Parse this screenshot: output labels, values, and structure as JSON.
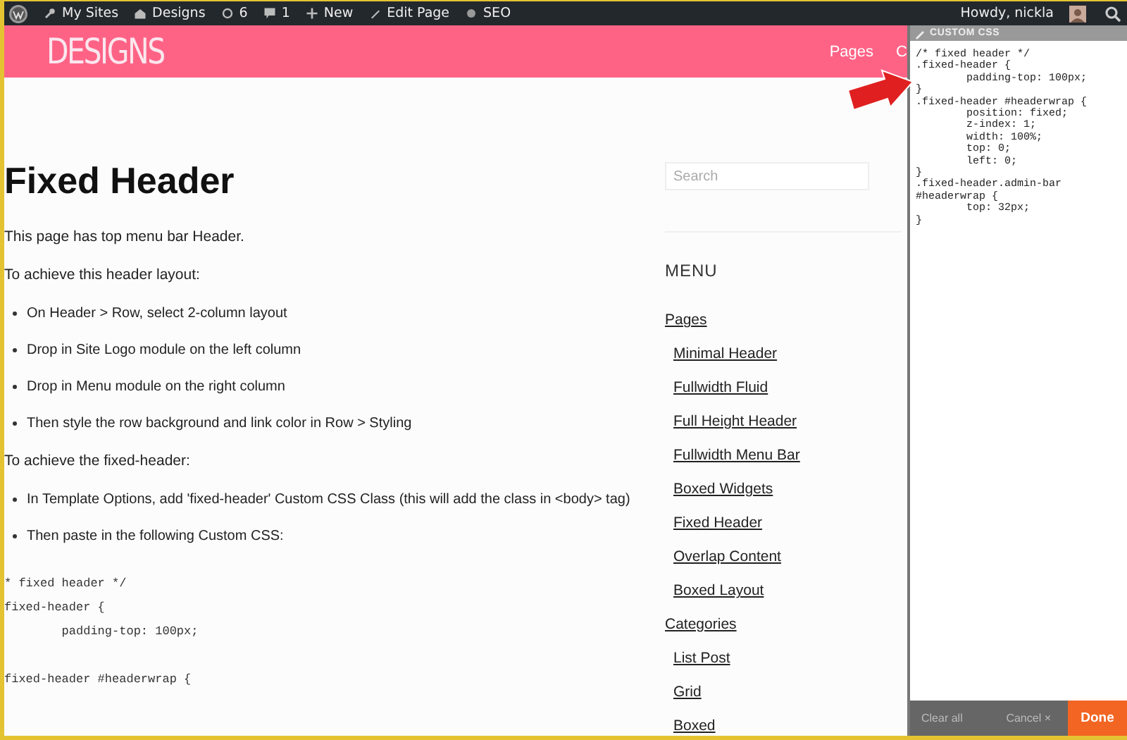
{
  "admin_bar": {
    "items": [
      {
        "kind": "sites",
        "label": "My Sites"
      },
      {
        "kind": "site",
        "label": "Designs"
      },
      {
        "kind": "updates",
        "label": "6"
      },
      {
        "kind": "comments",
        "label": "1"
      },
      {
        "kind": "new",
        "label": "New"
      },
      {
        "kind": "edit",
        "label": "Edit Page"
      },
      {
        "kind": "seo",
        "label": "SEO"
      }
    ],
    "greeting": "Howdy, nickla"
  },
  "header": {
    "logo": "DESIGNS",
    "nav": [
      "Pages",
      "C"
    ]
  },
  "page": {
    "title": "Fixed Header",
    "blocks": [
      {
        "kind": "p",
        "text": "This page has top menu bar Header."
      },
      {
        "kind": "p",
        "text": "To achieve this header layout:"
      },
      {
        "kind": "ul",
        "items": [
          "On Header > Row, select 2-column layout",
          "Drop in Site Logo module on the left column",
          "Drop in Menu module on the right column",
          "Then style the row background and link color in Row > Styling"
        ]
      },
      {
        "kind": "p",
        "text": "To achieve the fixed-header:"
      },
      {
        "kind": "ul",
        "items": [
          "In Template Options, add 'fixed-header' Custom CSS Class (this will add the class in <body> tag)",
          "Then paste in the following Custom CSS:"
        ]
      },
      {
        "kind": "code",
        "lines": [
          "* fixed header */",
          "fixed-header {",
          "        padding-top: 100px;"
        ]
      },
      {
        "kind": "code",
        "lines": [
          "fixed-header #headerwrap {"
        ]
      }
    ]
  },
  "sidebar": {
    "search": {
      "placeholder": "Search"
    },
    "menu_title": "MENU",
    "menu": [
      {
        "label": "Pages",
        "children": [
          {
            "label": "Minimal Header"
          },
          {
            "label": "Fullwidth Fluid"
          },
          {
            "label": "Full Height Header"
          },
          {
            "label": "Fullwidth Menu Bar"
          },
          {
            "label": "Boxed Widgets"
          },
          {
            "label": "Fixed Header"
          },
          {
            "label": "Overlap Content"
          },
          {
            "label": "Boxed Layout"
          }
        ]
      },
      {
        "label": "Categories",
        "children": [
          {
            "label": "List Post"
          },
          {
            "label": "Grid"
          },
          {
            "label": "Boxed"
          }
        ]
      }
    ]
  },
  "custom_css": {
    "title": "CUSTOM CSS",
    "code": "/* fixed header */\n.fixed-header {\n        padding-top: 100px;\n}\n.fixed-header #headerwrap {\n        position: fixed;\n        z-index: 1;\n        width: 100%;\n        top: 0;\n        left: 0;\n}\n.fixed-header.admin-bar\n#headerwrap {\n        top: 32px;\n}\n",
    "buttons": [
      {
        "kind": "clear",
        "label": "Clear all"
      },
      {
        "kind": "cancel",
        "label": "Cancel",
        "icon_text": "×"
      },
      {
        "kind": "done",
        "label": "Done"
      }
    ]
  }
}
